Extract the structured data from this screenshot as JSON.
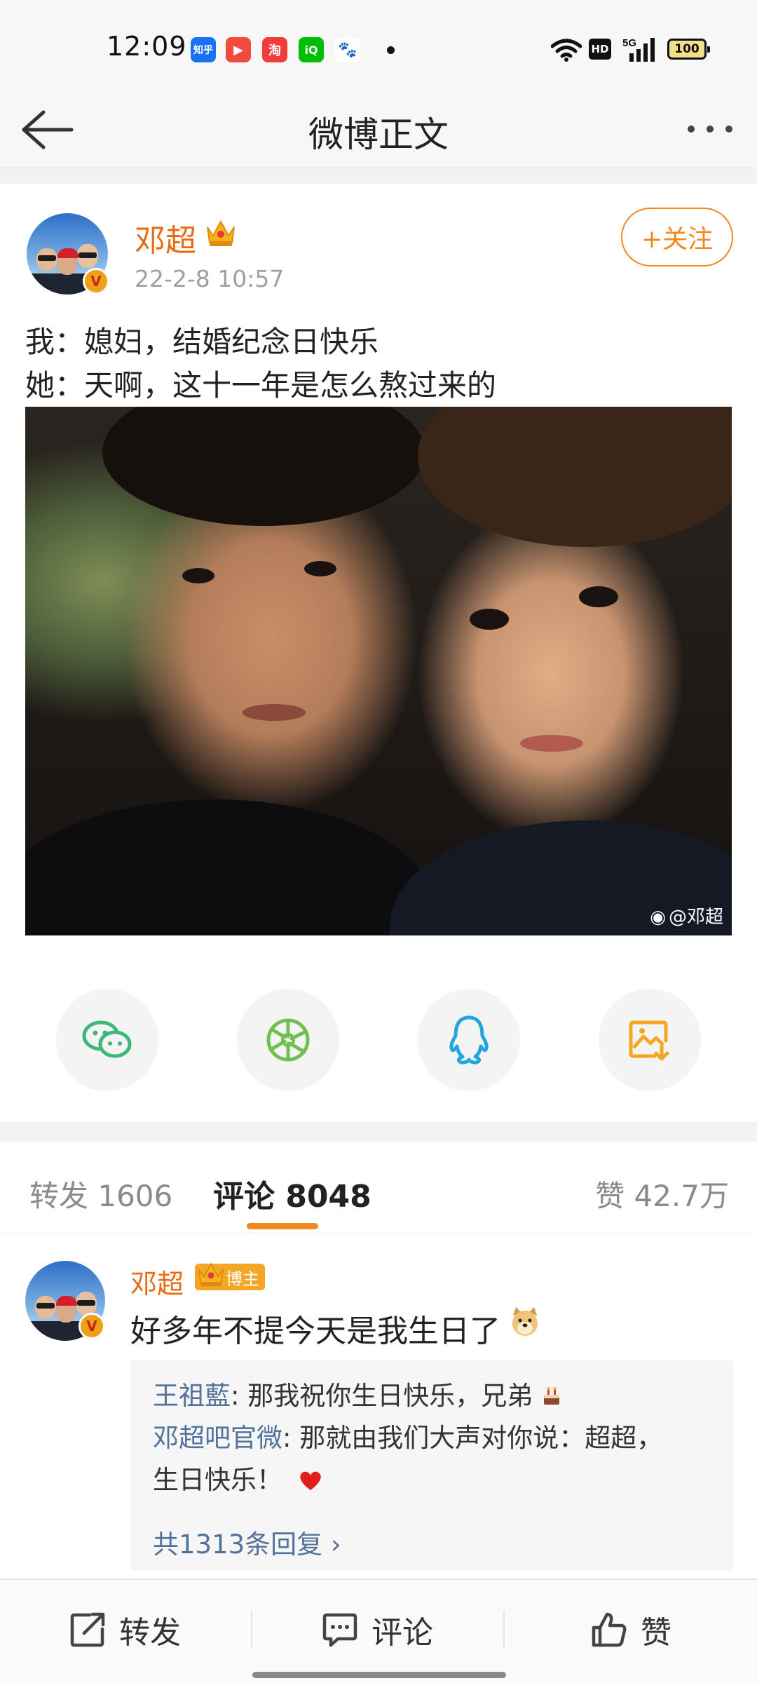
{
  "status_bar": {
    "time": "12:09",
    "apps": [
      {
        "name": "zhihu-icon",
        "label": "知乎",
        "color": "#1772f6"
      },
      {
        "name": "play-icon",
        "label": "▶",
        "color": "#f04b3d"
      },
      {
        "name": "taobao-icon",
        "label": "淘",
        "color": "#f23c3c"
      },
      {
        "name": "iqiyi-icon",
        "label": "iQ",
        "color": "#00be06"
      },
      {
        "name": "baidu-paw-icon",
        "label": "🐾",
        "color": "#ffffff"
      }
    ],
    "hd": "HD",
    "network": "5G",
    "battery": "100"
  },
  "nav": {
    "title": "微博正文"
  },
  "post": {
    "author": "邓超",
    "time": "22-2-8 10:57",
    "follow_label": "+关注",
    "lines": [
      "我：媳妇，结婚纪念日快乐",
      "她：天啊，这十一年是怎么熬过来的"
    ],
    "watermark": "@邓超",
    "verified_badge": "V"
  },
  "share": {
    "icons": [
      {
        "name": "wechat-icon",
        "color": "#3cb878"
      },
      {
        "name": "moments-icon",
        "color": "#6cc24a"
      },
      {
        "name": "qq-icon",
        "color": "#23a6e0"
      },
      {
        "name": "save-image-icon",
        "color": "#f5a623"
      }
    ]
  },
  "tabs": {
    "repost": "转发 1606",
    "comment": "评论 8048",
    "like": "赞 42.7万"
  },
  "comment": {
    "name": "邓超",
    "badge": "博主",
    "text": "好多年不提今天是我生日了",
    "replies": [
      {
        "user": "王祖藍",
        "text": ": 那我祝你生日快乐，兄弟"
      },
      {
        "user": "邓超吧官微",
        "text": ": 那就由我们大声对你说：超超，"
      },
      {
        "user": "",
        "text": "生日快乐！"
      }
    ],
    "more_replies": "共1313条回复 ›"
  },
  "bottom_bar": {
    "repost": "转发",
    "comment": "评论",
    "like": "赞"
  }
}
